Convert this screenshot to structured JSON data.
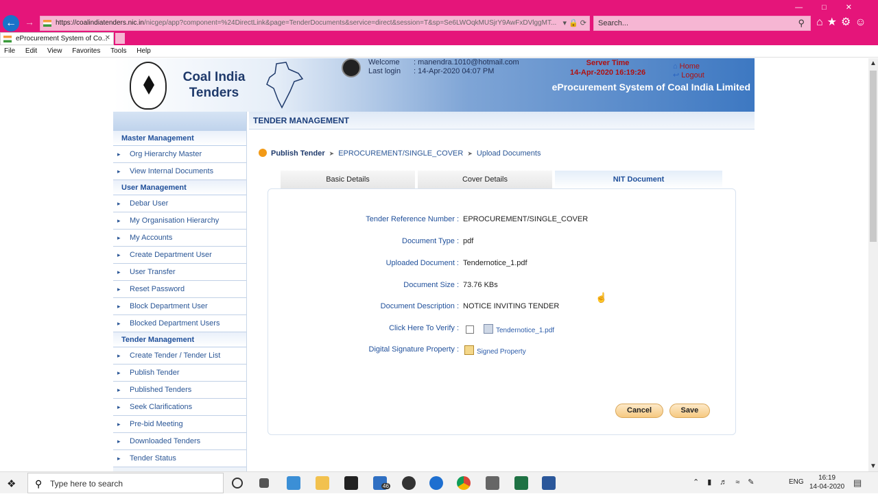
{
  "browser": {
    "url_host": "https://coalindiatenders.nic.in",
    "url_path": "/nicgep/app?component=%24DirectLink&page=TenderDocuments&service=direct&session=T&sp=Se6LWOqkMUSjrY9AwFxDVlggMT...",
    "search_placeholder": "Search...",
    "tab_title": "eProcurement System of Co...",
    "menu": [
      "File",
      "Edit",
      "View",
      "Favorites",
      "Tools",
      "Help"
    ]
  },
  "header": {
    "brand_line1": "Coal India",
    "brand_line2": "Tenders",
    "welcome_label": "Welcome",
    "welcome_value": ": manendra.1010@hotmail.com",
    "lastlogin_label": "Last login",
    "lastlogin_value": ": 14-Apr-2020 04:07 PM",
    "server_time_label": "Server Time",
    "server_time_value": "14-Apr-2020 16:19:26",
    "home": "Home",
    "logout": "Logout",
    "system_name": "eProcurement System of Coal India Limited"
  },
  "sidebar": {
    "master_title": "Master Management",
    "master_items": [
      "Org Hierarchy Master",
      "View Internal Documents"
    ],
    "user_title": "User Management",
    "user_items": [
      "Debar User",
      "My Organisation Hierarchy",
      "My Accounts",
      "Create Department User",
      "User Transfer",
      "Reset Password",
      "Block Department User",
      "Blocked Department Users"
    ],
    "tender_title": "Tender Management",
    "tender_items": [
      "Create Tender / Tender List",
      "Publish Tender",
      "Published Tenders",
      "Seek Clarifications",
      "Pre-bid Meeting",
      "Downloaded Tenders",
      "Tender Status"
    ]
  },
  "main": {
    "title": "TENDER MANAGEMENT",
    "crumb": [
      "Publish Tender",
      "EPROCUREMENT/SINGLE_COVER",
      "Upload Documents"
    ],
    "tabs": [
      "Basic Details",
      "Cover Details",
      "NIT Document"
    ],
    "fields": [
      {
        "label": "Tender Reference Number :",
        "value": "EPROCUREMENT/SINGLE_COVER"
      },
      {
        "label": "Document Type :",
        "value": "pdf"
      },
      {
        "label": "Uploaded Document :",
        "value": "Tendernotice_1.pdf"
      },
      {
        "label": "Document Size :",
        "value": "73.76  KBs"
      },
      {
        "label": "Document Description :",
        "value": "NOTICE INVITING TENDER"
      }
    ],
    "verify_label": "Click Here To Verify :",
    "verify_link": "Tendernotice_1.pdf",
    "signature_label": "Digital Signature Property :",
    "signature_link": "Signed Property",
    "cancel": "Cancel",
    "save": "Save"
  },
  "taskbar": {
    "search_text": "Type here to search",
    "lang": "ENG",
    "time": "16:19",
    "date": "14-04-2020",
    "mail_badge": "46"
  }
}
